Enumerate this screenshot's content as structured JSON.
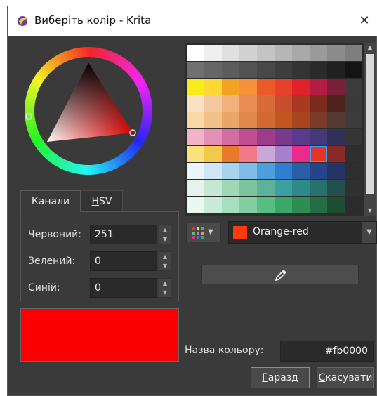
{
  "window": {
    "title": "Виберіть колір - Krita"
  },
  "tabs": [
    {
      "label": "Канали"
    },
    {
      "label_first": "H",
      "label_rest": "SV"
    }
  ],
  "channels": [
    {
      "label": "Червоний:",
      "value": "251"
    },
    {
      "label": "Зелений:",
      "value": "0"
    },
    {
      "label": "Синій:",
      "value": "0"
    }
  ],
  "current_color": "#fb0000",
  "palette": {
    "selected": {
      "row": 6,
      "col": 7
    },
    "rows": [
      [
        "#ffffff",
        "#efefef",
        "#e0e0e0",
        "#d2d2d2",
        "#c4c4c4",
        "#b6b6b6",
        "#a8a8a8",
        "#9a9a9a",
        "#8c8c8c",
        "#7e7e7e"
      ],
      [
        "#707070",
        "#666666",
        "#5c5c5c",
        "#525252",
        "#484848",
        "#3e3e3e",
        "#343434",
        "#2a2a2a",
        "#202020",
        "#141414"
      ],
      [
        "#f9ea1a",
        "#fdd835",
        "#f4a224",
        "#f6913c",
        "#ec5a2a",
        "#e8412b",
        "#e0222d",
        "#b31d45",
        "#7a1f3a",
        "#3b3b3b"
      ],
      [
        "#f9e2c4",
        "#f5c9a0",
        "#f1b27c",
        "#e88e55",
        "#d86a3a",
        "#c64e2b",
        "#a83a24",
        "#7c2a1e",
        "#4e231c",
        "#3a3a3a"
      ],
      [
        "#f7d8a6",
        "#f2c089",
        "#e9a669",
        "#e0884a",
        "#d06a32",
        "#c2561f",
        "#a84520",
        "#7c3a28",
        "#553a34",
        "#3c3c3c"
      ],
      [
        "#f3b2c8",
        "#e58fb6",
        "#d26ea3",
        "#bf4f92",
        "#9c3c8a",
        "#7a3a8c",
        "#5b3a8c",
        "#443a7a",
        "#303058",
        "#353535"
      ],
      [
        "#f9e27b",
        "#f3c94a",
        "#e87b2a",
        "#f07a8a",
        "#c9a7d9",
        "#a77fcf",
        "#ec2a8b",
        "#e5332a",
        "#8a2a28",
        "#2f2f2f"
      ],
      [
        "#eaf4fb",
        "#cfe6f6",
        "#a9d2ef",
        "#7fbde7",
        "#4d9fdc",
        "#2f7fd0",
        "#2a5fa8",
        "#26448a",
        "#233468",
        "#2e2e2e"
      ],
      [
        "#e6f3ec",
        "#c6e7d2",
        "#a2d7b6",
        "#7cc59a",
        "#5db39a",
        "#3aa0a0",
        "#2e8a8a",
        "#26706e",
        "#234f4d",
        "#303030"
      ],
      [
        "#eaf7f0",
        "#c9ecd8",
        "#a7dfbe",
        "#7fcf9f",
        "#56bf80",
        "#3aa866",
        "#2c8e52",
        "#236e42",
        "#1e4e32",
        "#2b2b2b"
      ]
    ]
  },
  "color_combo": {
    "swatch": "#fb3c0a",
    "name": "Orange-red"
  },
  "color_name": {
    "label": "Назва кольору:",
    "value": "#fb0000"
  },
  "buttons": {
    "ok": {
      "first": "Г",
      "rest": "аразд"
    },
    "cancel": {
      "first": "С",
      "rest": "касувати"
    }
  },
  "icons": [
    "krita-app-icon",
    "close-icon",
    "palette-grid-icon",
    "eyedropper-icon",
    "chevron-down-icon",
    "spin-up-icon",
    "spin-down-icon"
  ]
}
